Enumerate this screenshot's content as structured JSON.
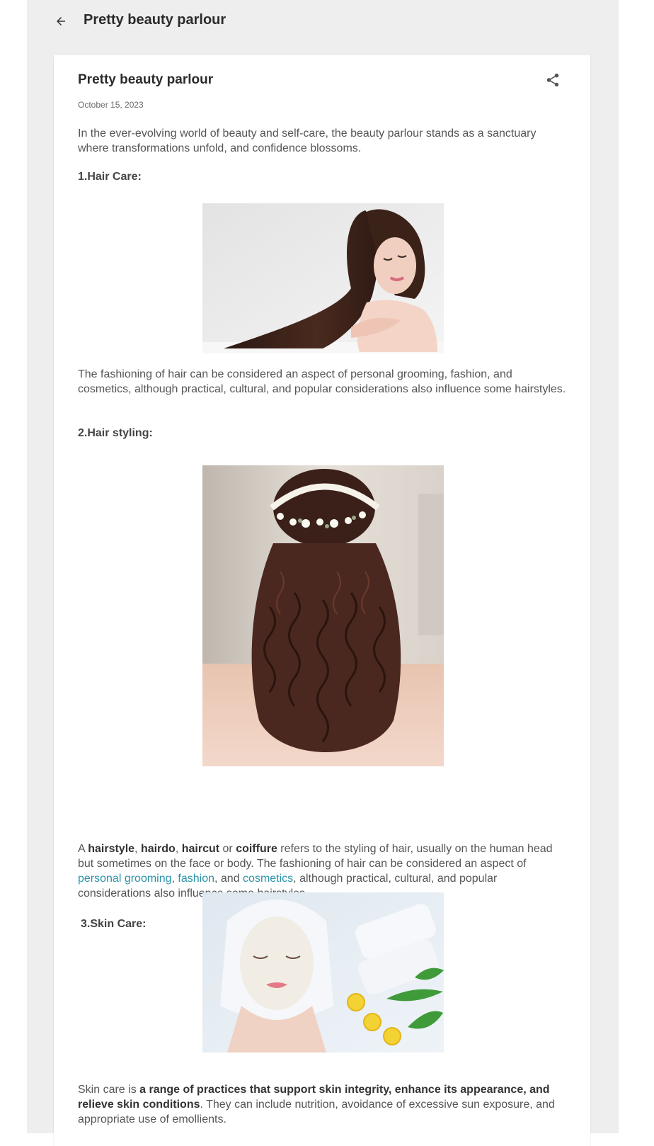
{
  "topbar": {
    "back_icon": "arrow-back-icon",
    "title": "Pretty beauty parlour"
  },
  "post": {
    "title": "Pretty beauty parlour",
    "share_icon": "share-icon",
    "date": "October 15, 2023",
    "intro": "In the ever-evolving world of beauty and self-care, the beauty parlour stands as a sanctuary where transformations unfold, and confidence blossoms.",
    "sections": [
      {
        "heading": "1.Hair Care:",
        "caption": "The fashioning of hair can be considered an aspect of personal grooming, fashion, and cosmetics, although practical, cultural, and popular considerations also influence some hairstyles."
      },
      {
        "heading": "2.Hair styling:",
        "text": {
          "t1": "A ",
          "b1": "hairstyle",
          "t2": ", ",
          "b2": "hairdo",
          "t3": ", ",
          "b3": "haircut",
          "t4": " or ",
          "b4": "coiffure",
          "t5": " refers to the styling of hair, usually on the human head but sometimes on the face or body. The fashioning of hair can be considered an aspect of ",
          "link1": "personal grooming",
          "t6": ", ",
          "link2": "fashion",
          "t7": ", and ",
          "link3": "cosmetics",
          "t8": ", although practical, cultural, and popular considerations also influence some hairstyles."
        }
      },
      {
        "heading": "3.Skin Care:",
        "text": {
          "t1": "Skin care is ",
          "b1": "a range of practices that support skin integrity, enhance its appearance, and relieve skin conditions",
          "t2": ". They can include nutrition, avoidance of excessive sun exposure, and appropriate use of emollients."
        }
      }
    ]
  },
  "colors": {
    "page_background": "#eeeeee",
    "card_background": "#ffffff",
    "link": "#2a93a8",
    "title": "#2b2b2b",
    "body_text": "#555555"
  }
}
